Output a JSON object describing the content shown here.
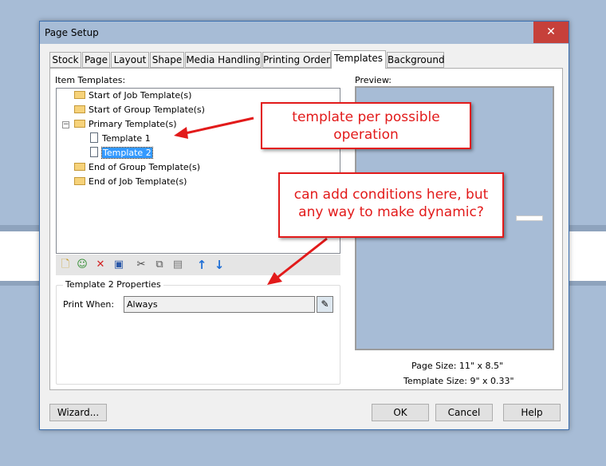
{
  "window": {
    "title": "Page Setup",
    "close_glyph": "✕"
  },
  "tabs": [
    {
      "label": "Stock"
    },
    {
      "label": "Page"
    },
    {
      "label": "Layout"
    },
    {
      "label": "Shape"
    },
    {
      "label": "Media Handling"
    },
    {
      "label": "Printing Order"
    },
    {
      "label": "Templates"
    },
    {
      "label": "Background"
    }
  ],
  "active_tab": "Templates",
  "item_templates": {
    "label": "Item Templates:",
    "nodes": [
      {
        "label": "Start of Job Template(s)",
        "icon": "folder-icon"
      },
      {
        "label": "Start of Group Template(s)",
        "icon": "folder-icon"
      },
      {
        "label": "Primary Template(s)",
        "icon": "folder-open-icon",
        "expander": "−"
      },
      {
        "label": "Template 1",
        "icon": "document-icon"
      },
      {
        "label": "Template 2",
        "icon": "document-icon",
        "selected": true
      },
      {
        "label": "End of Group Template(s)",
        "icon": "folder-icon"
      },
      {
        "label": "End of Job Template(s)",
        "icon": "folder-icon"
      }
    ]
  },
  "toolbar": {
    "icons": [
      "new-template-icon",
      "new-template-wizard-icon",
      "delete-icon",
      "properties-icon",
      "cut-icon",
      "copy-icon",
      "paste-icon",
      "move-up-icon",
      "move-down-icon"
    ],
    "glyphs": [
      "🗋",
      "☺",
      "✕",
      "▣",
      "✂",
      "⧉",
      "▤",
      "↑",
      "↓"
    ]
  },
  "properties": {
    "title": "Template 2 Properties",
    "print_when_label": "Print When:",
    "print_when_value": "Always"
  },
  "preview": {
    "label": "Preview:",
    "page_size": "Page Size:  11\" x 8.5\"",
    "template_size": "Template Size:  9\" x 0.33\""
  },
  "buttons": {
    "wizard": "Wizard...",
    "ok": "OK",
    "cancel": "Cancel",
    "help": "Help"
  },
  "callouts": {
    "top": "template per possible operation",
    "bottom": "can add conditions here, but any way to make dynamic?"
  },
  "colors": {
    "callout_red": "#e21a1a",
    "selection_blue": "#3399ff",
    "close_red": "#c6403a"
  }
}
